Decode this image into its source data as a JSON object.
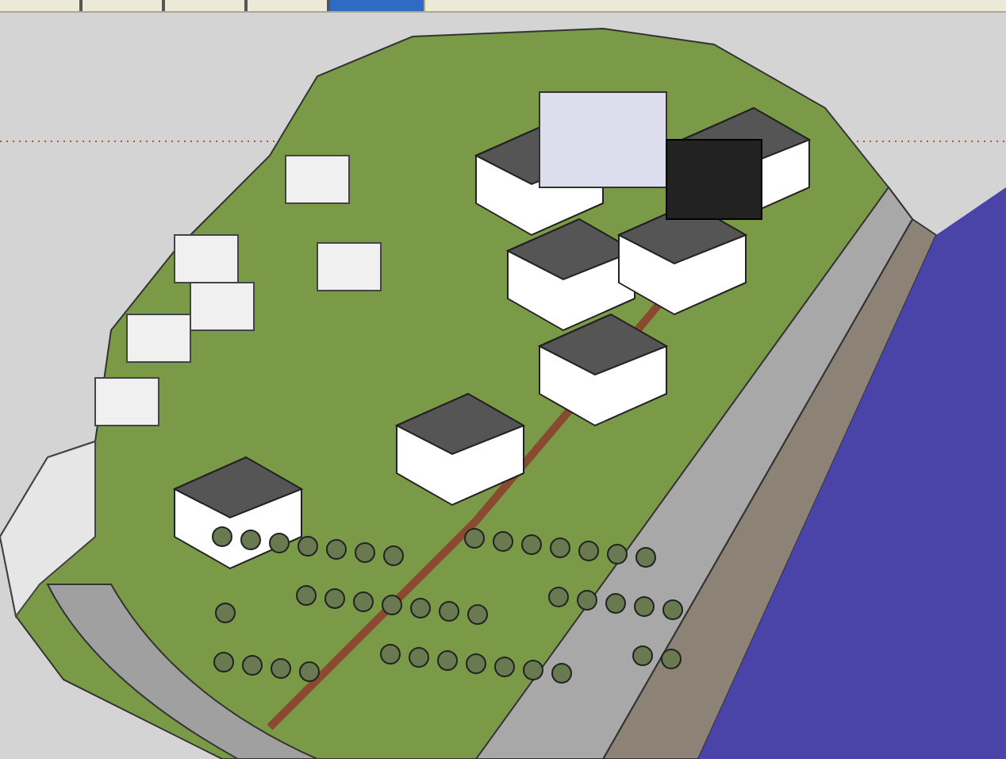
{
  "scene_tabs": [
    {
      "selected": false
    },
    {
      "selected": false
    },
    {
      "selected": false
    },
    {
      "selected": false
    },
    {
      "selected": true
    }
  ]
}
